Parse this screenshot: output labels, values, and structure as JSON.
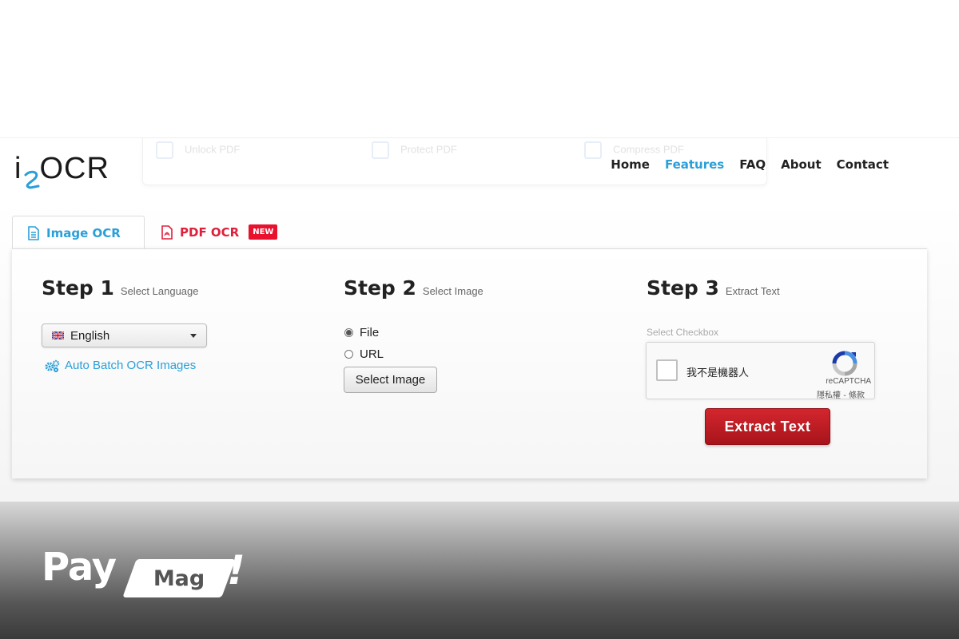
{
  "header": {
    "logo_text": "OCR",
    "ghost_menu": [
      "Unlock PDF",
      "Protect PDF",
      "Compress PDF"
    ],
    "nav": [
      {
        "label": "Home",
        "active": false
      },
      {
        "label": "Features",
        "active": true
      },
      {
        "label": "FAQ",
        "active": false
      },
      {
        "label": "About",
        "active": false
      },
      {
        "label": "Contact",
        "active": false
      }
    ]
  },
  "tabs": {
    "image_ocr": "Image OCR",
    "pdf_ocr": "PDF OCR",
    "new_badge": "NEW"
  },
  "step1": {
    "title": "Step 1",
    "subtitle": "Select Language",
    "language": "English",
    "batch_link": "Auto Batch OCR Images"
  },
  "step2": {
    "title": "Step 2",
    "subtitle": "Select Image",
    "options": [
      {
        "label": "File",
        "checked": true
      },
      {
        "label": "URL",
        "checked": false
      }
    ],
    "button": "Select Image"
  },
  "step3": {
    "title": "Step 3",
    "subtitle": "Extract Text",
    "checkbox_label": "Select Checkbox",
    "recaptcha": {
      "text": "我不是機器人",
      "brand": "reCAPTCHA",
      "terms": "隱私權 - 條款"
    },
    "button": "Extract Text"
  },
  "watermark": {
    "pay": "Pay",
    "mag": "Mag",
    "exclaim": "!"
  },
  "colors": {
    "accent_blue": "#2a9fd8",
    "pdf_red": "#e0203a",
    "extract_red": "#c01f26"
  }
}
